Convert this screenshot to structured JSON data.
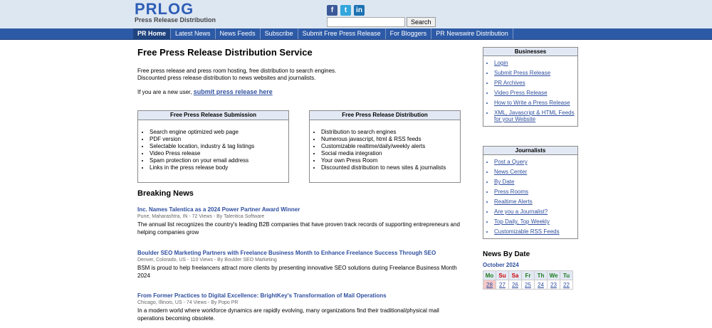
{
  "header": {
    "logo": "PRLOG",
    "tagline": "Press Release Distribution",
    "search_button": "Search",
    "social": [
      "facebook-icon",
      "twitter-icon",
      "linkedin-icon"
    ]
  },
  "nav": [
    "PR Home",
    "Latest News",
    "News Feeds",
    "Subscribe",
    "Submit Free Press Release",
    "For Bloggers",
    "PR Newswire Distribution"
  ],
  "main": {
    "title": "Free Press Release Distribution Service",
    "intro_line1": "Free press release and press room hosting, free distribution to search engines.",
    "intro_line2": "Discounted press release distribution to news websites and journalists.",
    "newuser_text": "If you are a new user,",
    "newuser_link": "submit press release here"
  },
  "submission_box": {
    "title": "Free Press Release Submission",
    "items": [
      "Search engine optimized web page",
      "PDF version",
      "Selectable location, industry & tag listings",
      "Video Press release",
      "Spam protection on your email address",
      "Links in the press release body"
    ]
  },
  "distribution_box": {
    "title": "Free Press Release Distribution",
    "items": [
      "Distribution to search engines",
      "Numerous javascript, html & RSS feeds",
      "Customizable realtime/daily/weekly alerts",
      "Social media integration",
      "Your own Press Room",
      "Discounted distribution to news sites & journalists"
    ]
  },
  "breaking": {
    "heading": "Breaking News",
    "items": [
      {
        "title": "Inc. Names Talentica as a 2024 Power Partner Award Winner",
        "meta": "Pune, Maharashtra, IN - 72 Views - By Talentica Software",
        "summary": "The annual list recognizes the country's leading B2B companies that have proven track records of supporting entrepreneurs and helping companies grow"
      },
      {
        "title": "Boulder SEO Marketing Partners with Freelance Business Month to Enhance Freelance Success Through SEO",
        "meta": "Denver, Colorado, US - 110 Views - By Boulder SEO Marketing",
        "summary": "BSM is proud to help freelancers attract more clients by presenting innovative SEO solutions during Freelance Business Month 2024"
      },
      {
        "title": "From Former Practices to Digital Excellence: BrightKey's Transformation of Mail Operations",
        "meta": "Chicago, Illinois, US - 74 Views - By Popo PR",
        "summary": "In a modern world where workforce dynamics are rapidly evolving, many organizations find their traditional/physical mail operations becoming obsolete."
      }
    ]
  },
  "businesses": {
    "title": "Businesses",
    "links": [
      "Login",
      "Submit Press Release",
      "PR Archives",
      "Video Press Release",
      "How to Write a Press Release",
      "XML, Javascript & HTML Feeds for your Website"
    ]
  },
  "journalists": {
    "title": "Journalists",
    "links": [
      "Post a Query",
      "News Center",
      "By Date",
      "Press Rooms",
      "Realtime Alerts",
      "Are you a Journalist?",
      "Customizable RSS Feeds"
    ],
    "top_daily": "Top Daily,",
    "top_weekly": "Top Weekly"
  },
  "calendar": {
    "heading": "News By Date",
    "month": "October 2024",
    "days": [
      "Mo",
      "Su",
      "Sa",
      "Fr",
      "Th",
      "We",
      "Tu"
    ],
    "dates": [
      "28",
      "27",
      "26",
      "25",
      "24",
      "23",
      "22"
    ]
  }
}
